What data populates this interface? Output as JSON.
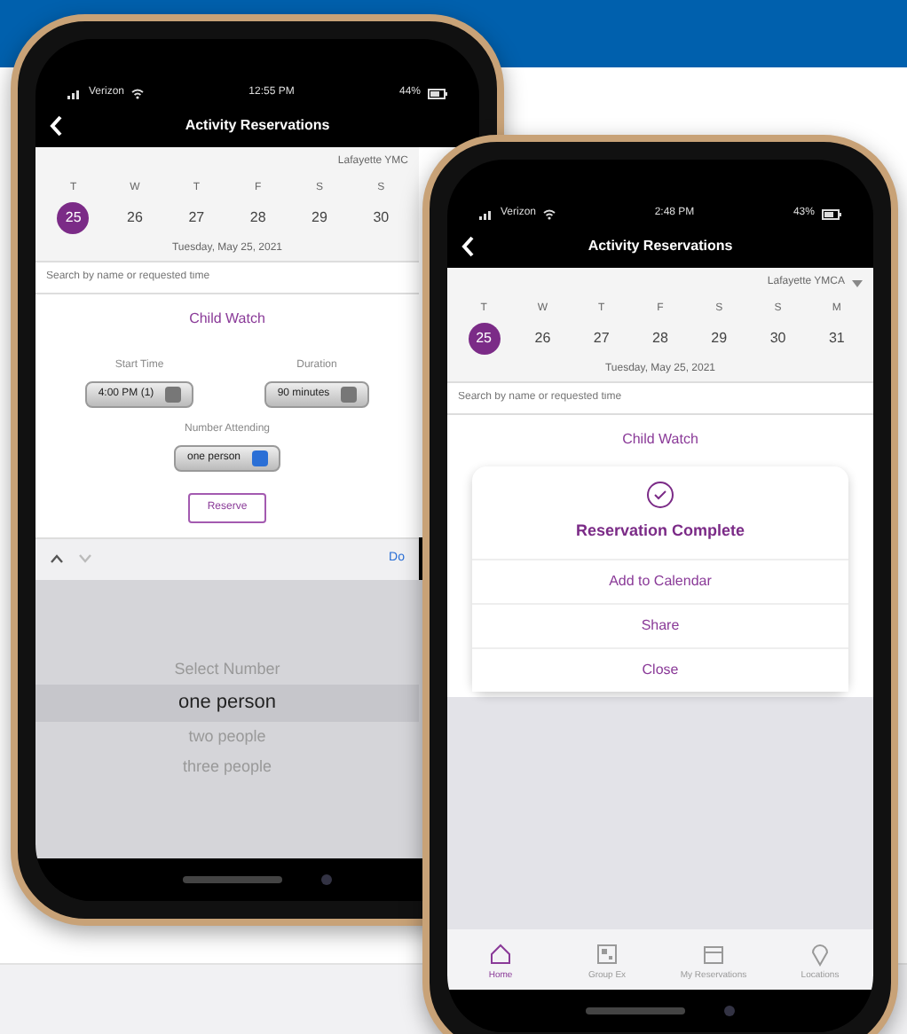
{
  "phones": [
    {
      "status": {
        "carrier": "Verizon",
        "time": "12:55 PM",
        "battery": "44%"
      },
      "title": "Activity Reservations",
      "location": "Lafayette YMC",
      "days": [
        {
          "letter": "T",
          "date": "25",
          "selected": true
        },
        {
          "letter": "W",
          "date": "26",
          "selected": false
        },
        {
          "letter": "T",
          "date": "27",
          "selected": false
        },
        {
          "letter": "F",
          "date": "28",
          "selected": false
        },
        {
          "letter": "S",
          "date": "29",
          "selected": false
        },
        {
          "letter": "S",
          "date": "30",
          "selected": false
        }
      ],
      "date_text": "Tuesday, May 25, 2021",
      "search": {
        "placeholder": "Search by name or requested time"
      },
      "activity": "Child Watch",
      "form": {
        "start_label": "Start Time",
        "start_value": "4:00 PM (1)",
        "duration_label": "Duration",
        "duration_value": "90 minutes",
        "attending_label": "Number Attending",
        "attending_value": "one person",
        "reserve": "Reserve"
      },
      "keyboard_bar": {
        "done": "Do"
      },
      "picker": [
        {
          "label": "Select Number",
          "selected": false
        },
        {
          "label": "one person",
          "selected": true
        },
        {
          "label": "two people",
          "selected": false
        },
        {
          "label": "three people",
          "selected": false
        }
      ]
    },
    {
      "status": {
        "carrier": "Verizon",
        "time": "2:48 PM",
        "battery": "43%"
      },
      "title": "Activity Reservations",
      "location": "Lafayette YMCA",
      "days": [
        {
          "letter": "T",
          "date": "25",
          "selected": true
        },
        {
          "letter": "W",
          "date": "26",
          "selected": false
        },
        {
          "letter": "T",
          "date": "27",
          "selected": false
        },
        {
          "letter": "F",
          "date": "28",
          "selected": false
        },
        {
          "letter": "S",
          "date": "29",
          "selected": false
        },
        {
          "letter": "S",
          "date": "30",
          "selected": false
        },
        {
          "letter": "M",
          "date": "31",
          "selected": false
        }
      ],
      "date_text": "Tuesday, May 25, 2021",
      "search": {
        "placeholder": "Search by name or requested time"
      },
      "activity": "Child Watch",
      "modal": {
        "title": "Reservation Complete",
        "actions": [
          "Add to Calendar",
          "Share",
          "Close"
        ]
      },
      "tab_bar": [
        {
          "label": "Home",
          "selected": true
        },
        {
          "label": "Group Ex",
          "selected": false
        },
        {
          "label": "My Reservations",
          "selected": false
        },
        {
          "label": "Locations",
          "selected": false
        }
      ]
    }
  ]
}
